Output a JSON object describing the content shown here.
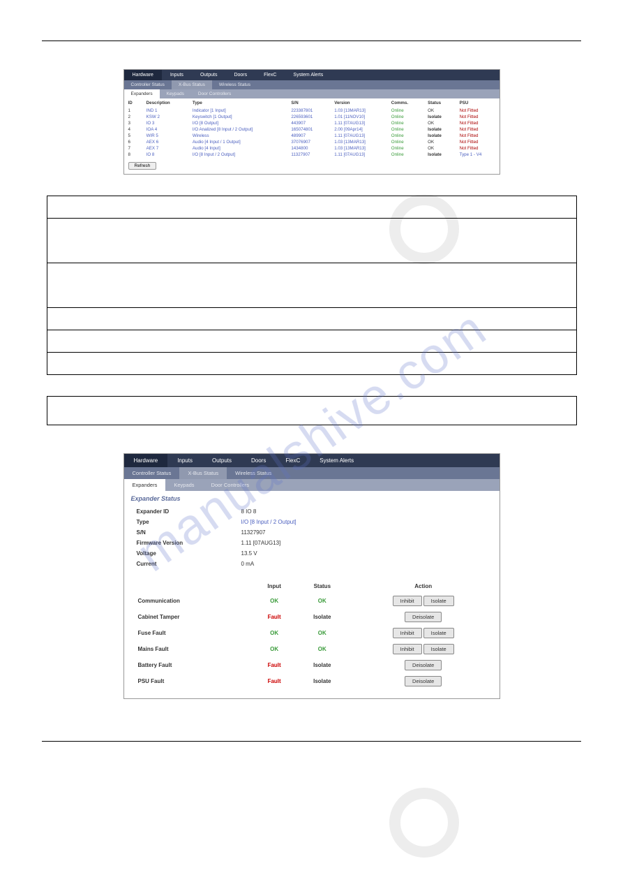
{
  "watermark": "manualshive.com",
  "bar1": {
    "items": [
      "Hardware",
      "Inputs",
      "Outputs",
      "Doors",
      "FlexC",
      "System Alerts"
    ],
    "active": 0
  },
  "bar2": {
    "items": [
      "Controller Status",
      "X-Bus Status",
      "Wireless Status"
    ],
    "active": 1
  },
  "bar3": {
    "items": [
      "Expanders",
      "Keypads",
      "Door Controllers"
    ],
    "active": 0
  },
  "table1": {
    "headers": [
      "ID",
      "Description",
      "Type",
      "S/N",
      "Version",
      "Comms.",
      "Status",
      "PSU"
    ],
    "rows": [
      {
        "id": "1",
        "desc": "IND 1",
        "type": "Indicator [1 Input]",
        "sn": "223387801",
        "ver": "1.03 [13MAR13]",
        "comms": "Online",
        "status": "OK",
        "statusBold": false,
        "psu": "Not Fitted"
      },
      {
        "id": "2",
        "desc": "KSW 2",
        "type": "Keyswitch [1 Output]",
        "sn": "226593601",
        "ver": "1.01 [11NOV10]",
        "comms": "Online",
        "status": "Isolate",
        "statusBold": true,
        "psu": "Not Fitted"
      },
      {
        "id": "3",
        "desc": "IO 3",
        "type": "I/O [8 Output]",
        "sn": "443907",
        "ver": "1.11 [07AUG13]",
        "comms": "Online",
        "status": "OK",
        "statusBold": false,
        "psu": "Not Fitted"
      },
      {
        "id": "4",
        "desc": "IOA 4",
        "type": "I/O Analized [8 Input / 2 Output]",
        "sn": "165074801",
        "ver": "2.00 [09Apr14]",
        "comms": "Online",
        "status": "Isolate",
        "statusBold": true,
        "psu": "Not Fitted"
      },
      {
        "id": "5",
        "desc": "WIR 5",
        "type": "Wireless",
        "sn": "489907",
        "ver": "1.11 [07AUG13]",
        "comms": "Online",
        "status": "Isolate",
        "statusBold": true,
        "psu": "Not Fitted"
      },
      {
        "id": "6",
        "desc": "AEX 6",
        "type": "Audio [4 Input / 1 Output]",
        "sn": "37076907",
        "ver": "1.03 [13MAR13]",
        "comms": "Online",
        "status": "OK",
        "statusBold": false,
        "psu": "Not Fitted"
      },
      {
        "id": "7",
        "desc": "AEX 7",
        "type": "Audio [4 Input]",
        "sn": "1434800",
        "ver": "1.03 [13MAR13]",
        "comms": "Online",
        "status": "OK",
        "statusBold": false,
        "psu": "Not Fitted"
      },
      {
        "id": "8",
        "desc": "IO 8",
        "type": "I/O [8 Input / 2 Output]",
        "sn": "11327907",
        "ver": "1.11 [07AUG13]",
        "comms": "Online",
        "status": "Isolate",
        "statusBold": true,
        "psu": "Type 1 - V4",
        "psuLink": true
      }
    ],
    "refresh": "Refresh"
  },
  "panel2": {
    "title": "Expander Status",
    "kv": [
      {
        "k": "Expander ID",
        "v": "8 IO 8"
      },
      {
        "k": "Type",
        "v": "I/O [8 Input / 2 Output]",
        "link": true
      },
      {
        "k": "S/N",
        "v": "11327907"
      },
      {
        "k": "Firmware Version",
        "v": "1.11 [07AUG13]"
      },
      {
        "k": "Voltage",
        "v": "13.5 V"
      },
      {
        "k": "Current",
        "v": "0 mA"
      }
    ],
    "sheaders": [
      "",
      "Input",
      "Status",
      "Action"
    ],
    "srows": [
      {
        "name": "Communication",
        "input": "OK",
        "inputCls": "ok",
        "status": "OK",
        "statusCls": "ok",
        "actions": [
          "Inhibit",
          "Isolate"
        ]
      },
      {
        "name": "Cabinet Tamper",
        "input": "Fault",
        "inputCls": "red",
        "status": "Isolate",
        "statusCls": "",
        "actions": [
          "Deisolate"
        ]
      },
      {
        "name": "Fuse Fault",
        "input": "OK",
        "inputCls": "ok",
        "status": "OK",
        "statusCls": "ok",
        "actions": [
          "Inhibit",
          "Isolate"
        ]
      },
      {
        "name": "Mains Fault",
        "input": "OK",
        "inputCls": "ok",
        "status": "OK",
        "statusCls": "ok",
        "actions": [
          "Inhibit",
          "Isolate"
        ]
      },
      {
        "name": "Battery Fault",
        "input": "Fault",
        "inputCls": "red",
        "status": "Isolate",
        "statusCls": "",
        "actions": [
          "Deisolate"
        ]
      },
      {
        "name": "PSU Fault",
        "input": "Fault",
        "inputCls": "red",
        "status": "Isolate",
        "statusCls": "",
        "actions": [
          "Deisolate"
        ]
      }
    ]
  }
}
